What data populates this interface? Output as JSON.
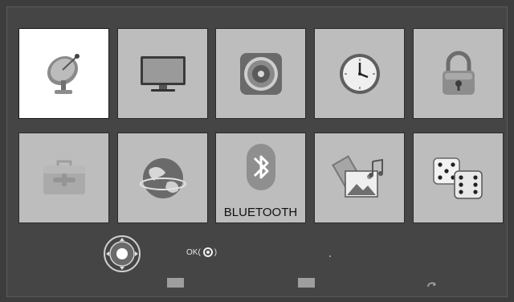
{
  "menu": {
    "tiles": [
      {
        "id": "satellite",
        "icon": "satellite-dish-icon",
        "selected": true,
        "label": ""
      },
      {
        "id": "picture",
        "icon": "tv-monitor-icon",
        "selected": false,
        "label": ""
      },
      {
        "id": "sound",
        "icon": "speaker-icon",
        "selected": false,
        "label": ""
      },
      {
        "id": "time",
        "icon": "clock-icon",
        "selected": false,
        "label": ""
      },
      {
        "id": "lock",
        "icon": "padlock-icon",
        "selected": false,
        "label": ""
      },
      {
        "id": "tools",
        "icon": "toolbox-icon",
        "selected": false,
        "label": ""
      },
      {
        "id": "network",
        "icon": "globe-icon",
        "selected": false,
        "label": ""
      },
      {
        "id": "bluetooth",
        "icon": "bluetooth-icon",
        "selected": false,
        "label": "BLUETOOTH"
      },
      {
        "id": "media",
        "icon": "media-photos-icon",
        "selected": false,
        "label": ""
      },
      {
        "id": "games",
        "icon": "dice-icon",
        "selected": false,
        "label": ""
      }
    ]
  },
  "footer": {
    "ok_prefix": "OK(",
    "ok_suffix": ")",
    "nav_icon": "directional-pad-icon",
    "return_icon": "return-arrow-icon"
  },
  "colors": {
    "background": "#3d3d3d",
    "tile": "#bdbdbd",
    "tile_selected": "#ffffff"
  }
}
